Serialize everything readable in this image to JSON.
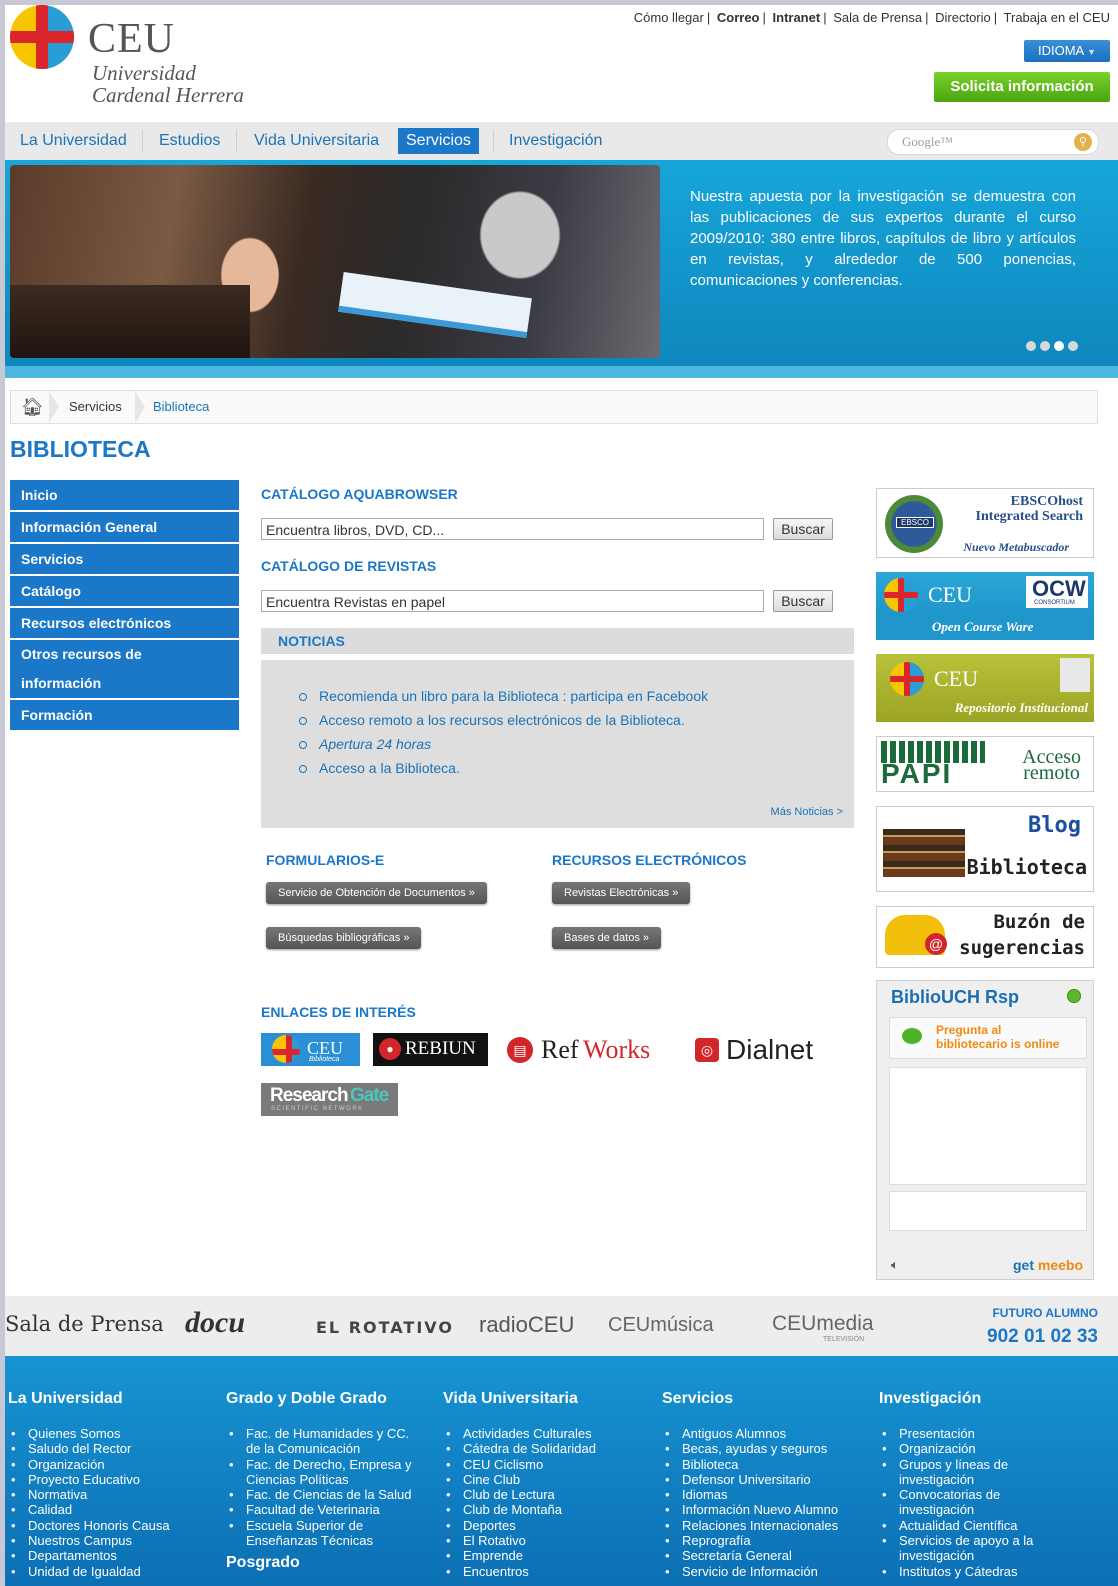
{
  "header": {
    "logo_ceu": "CEU",
    "logo_line1": "Universidad",
    "logo_line2": "Cardenal Herrera",
    "toplinks": [
      "Cómo llegar",
      "Correo",
      "Intranet",
      "Sala de Prensa",
      "Directorio",
      "Trabaja en el CEU"
    ],
    "idioma": "IDIOMA",
    "solicita": "Solicita información"
  },
  "nav": {
    "items": [
      "La Universidad",
      "Estudios",
      "Vida Universitaria",
      "Servicios",
      "Investigación"
    ],
    "active": "Servicios",
    "search_placeholder": "Google™"
  },
  "hero": {
    "text": "Nuestra apuesta por la investigación se demuestra con las publicaciones de sus expertos durante el curso 2009/2010: 380 entre libros, capítulos de libro y artículos en revistas, y alrededor de 500 ponencias, comunicaciones y conferencias."
  },
  "breadcrumb": {
    "c1": "Servicios",
    "c2": "Biblioteca"
  },
  "page_title": "BIBLIOTECA",
  "left_menu": [
    "Inicio",
    "Información General",
    "Servicios",
    "Catálogo",
    "Recursos electrónicos",
    "Otros recursos de",
    "información",
    "Formación"
  ],
  "catalogo": {
    "title": "CATÁLOGO AQUABROWSER",
    "value": "Encuentra libros, DVD, CD...",
    "button": "Buscar"
  },
  "revistas": {
    "title": "CATÁLOGO DE REVISTAS",
    "value": "Encuentra Revistas en papel",
    "button": "Buscar"
  },
  "noticias": {
    "title": "NOTICIAS",
    "items": [
      "Recomienda un libro para la Biblioteca : participa en Facebook",
      "Acceso remoto a los recursos electrónicos de la Biblioteca.",
      "Apertura 24 horas",
      "Acceso a la Biblioteca."
    ],
    "more": "Más Noticias >"
  },
  "formularios": {
    "title": "FORMULARIOS-E",
    "b1": "Servicio de Obtención de Documentos »",
    "b2": "Búsquedas bibliográficas »"
  },
  "recursos": {
    "title": "RECURSOS ELECTRÓNICOS",
    "b1": "Revistas Electrónicas »",
    "b2": "Bases de datos »"
  },
  "enlaces": {
    "title": "ENLACES DE INTERÉS",
    "ceu": "CEU",
    "ceu_sub": "Biblioteca",
    "rebiun": "REBIUN",
    "ref": "Ref",
    "works": "Works",
    "dialnet": "Dialnet",
    "rg1": "Research",
    "rg2": "Gate",
    "rg_sub": "SCIENTIFIC NETWORK"
  },
  "right": {
    "ebsco1": "EBSCOhost",
    "ebsco2": "Integrated Search",
    "ebsco3": "Nuevo Metabuscador",
    "ebsco_badge": "EBSCO",
    "ocw_ceu": "CEU",
    "ocw": "OCW",
    "ocw_sub": "CONSORTIUM",
    "ocw_line": "Open Course Ware",
    "rep_ceu": "CEU",
    "rep_line": "Repositorio Institucional",
    "papi": "PAPI",
    "acceso1": "Acceso",
    "acceso2": "remoto",
    "blog1": "Blog",
    "blog2": "Biblioteca",
    "buzon1": "Buzón de",
    "buzon2": "sugerencias"
  },
  "chat": {
    "title": "BiblioUCH Rsp",
    "status1": "Pregunta al",
    "status2": "bibliotecario is online",
    "get": "get",
    "meebo": "meebo"
  },
  "brands": [
    "Sala de Prensa",
    "docu",
    "EL ROTATIVO",
    "radioCEU",
    "CEUmúsica",
    "CEUmedia"
  ],
  "brands_sub": "TELEVISIÓN",
  "futuro": "FUTURO ALUMNO",
  "phone": "902 01 02 33",
  "footer": {
    "cols": [
      {
        "title": "La Universidad",
        "items": [
          "Quienes Somos",
          "Saludo del Rector",
          "Organización",
          "Proyecto Educativo",
          "Normativa",
          "Calidad",
          "Doctores Honoris Causa",
          "Nuestros Campus",
          "Departamentos",
          "Unidad de Igualdad"
        ]
      },
      {
        "title": "Grado y Doble Grado",
        "items": [
          "Fac. de Humanidades y CC. de la Comunicación",
          "Fac. de Derecho, Empresa y Ciencias Políticas",
          "Fac. de Ciencias de la Salud",
          "Facultad de Veterinaria",
          "Escuela Superior de Enseñanzas Técnicas"
        ],
        "sub": "Posgrado"
      },
      {
        "title": "Vida Universitaria",
        "items": [
          "Actividades Culturales",
          "Cátedra de Solidaridad",
          "CEU Ciclismo",
          "Cine Club",
          "Club de Lectura",
          "Club de Montaña",
          "Deportes",
          "El Rotativo",
          "Emprende",
          "Encuentros"
        ]
      },
      {
        "title": "Servicios",
        "items": [
          "Antiguos Alumnos",
          "Becas, ayudas y seguros",
          "Biblioteca",
          "Defensor Universitario",
          "Idiomas",
          "Información Nuevo Alumno",
          "Relaciones Internacionales",
          "Reprografía",
          "Secretaría General",
          "Servicio de Información"
        ]
      },
      {
        "title": "Investigación",
        "items": [
          "Presentación",
          "Organización",
          "Grupos y líneas de investigación",
          "Convocatorias de investigación",
          "Actualidad Científica",
          "Servicios de apoyo a la investigación",
          "Institutos y Cátedras"
        ]
      }
    ]
  },
  "colors": {
    "brand_blue": "#1b77c7",
    "green": "#4aa410",
    "hero": "#17a6d8"
  }
}
